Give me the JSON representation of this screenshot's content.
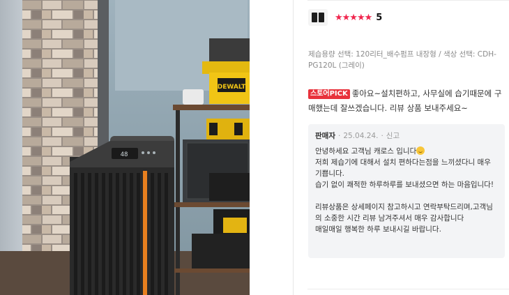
{
  "review": {
    "rating_stars": "★★★★★",
    "rating_value": "5",
    "option_text": "제습용량 선택: 120리터_배수펌프 내장형 / 색상 선택: CDH-PG120L (그레이)",
    "badge": "스토어PICK",
    "text": "좋아요~설치편하고, 사무실에 습기때문에 구매했는데 잘쓰겠습니다. 리뷰 상품 보내주세요~"
  },
  "seller_reply": {
    "author": "판매자",
    "date": "25.04.24.",
    "separator": "·",
    "report": "신고",
    "body_line1": "안녕하세요 고객님 캐로스 입니다",
    "body_rest": "저희 제습기에 대해서 설치 편하다는점을 느끼셨다니 매우 기쁩니다.\n습기 없이 쾌적한 하루하루를 보내셨으면 하는 마음입니다!\n\n리뷰상품은 상세페이지 참고하시고 연락부탁드리며,고객님의 소중한 시간 리뷰 남겨주셔서 매우 감사합니다\n매일매일 행복한 하루 보내시길 바랍니다."
  },
  "photo": {
    "display_text": "48",
    "toolbox_brand": "DEWALT"
  },
  "colors": {
    "star": "#f0264e",
    "badge": "#e8323c",
    "reply_bg": "#f3f4f6",
    "accent_orange": "#e8801f"
  }
}
